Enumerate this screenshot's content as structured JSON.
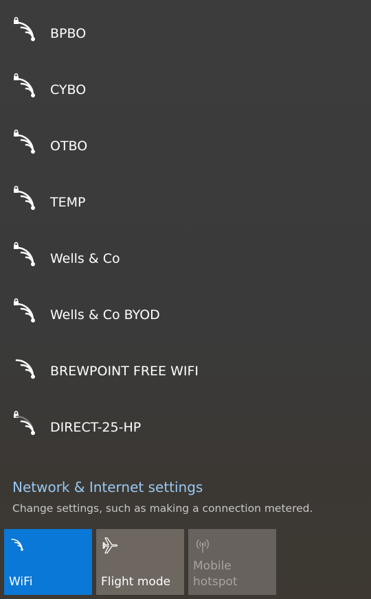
{
  "networks": [
    {
      "name": "BPBO",
      "secured": true,
      "signal": "full"
    },
    {
      "name": "CYBO",
      "secured": true,
      "signal": "full"
    },
    {
      "name": "OTBO",
      "secured": true,
      "signal": "full"
    },
    {
      "name": "TEMP",
      "secured": true,
      "signal": "full"
    },
    {
      "name": "Wells & Co",
      "secured": true,
      "signal": "full"
    },
    {
      "name": "Wells & Co BYOD",
      "secured": true,
      "signal": "full"
    },
    {
      "name": "BREWPOINT FREE WIFI",
      "secured": false,
      "signal": "full"
    },
    {
      "name": "DIRECT-25-HP",
      "secured": true,
      "signal": "low"
    }
  ],
  "settings": {
    "link": "Network & Internet settings",
    "description": "Change settings, such as making a connection metered."
  },
  "quick_actions": [
    {
      "label": "WiFi",
      "icon": "wifi-icon",
      "state": "on",
      "color": "#0a78d6"
    },
    {
      "label": "Flight mode",
      "icon": "airplane-icon",
      "state": "off",
      "color": "#6d6760"
    },
    {
      "label": "Mobile hotspot",
      "icon": "hotspot-icon",
      "state": "disabled",
      "color": "#67625d"
    }
  ],
  "colors": {
    "link": "#99c8f0",
    "accent": "#0a78d6"
  }
}
